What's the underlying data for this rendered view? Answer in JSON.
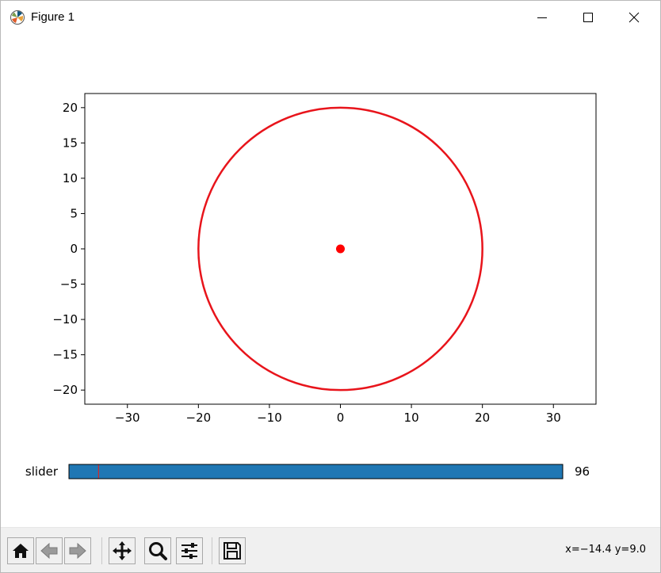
{
  "window": {
    "title": "Figure 1"
  },
  "chart_data": {
    "type": "line",
    "title": "",
    "xlabel": "",
    "ylabel": "",
    "xlim": [
      -36,
      36
    ],
    "ylim": [
      -22,
      22
    ],
    "xticks": [
      -30,
      -20,
      -10,
      0,
      10,
      20,
      30
    ],
    "yticks": [
      -20,
      -15,
      -10,
      -5,
      0,
      5,
      10,
      15,
      20
    ],
    "grid": false,
    "series": [
      {
        "kind": "circle",
        "center": [
          0,
          0
        ],
        "radius": 20,
        "color": "#e8141b"
      },
      {
        "kind": "point",
        "x": 0,
        "y": 0,
        "color": "#ff0000"
      }
    ],
    "aspect": "equal"
  },
  "slider": {
    "label": "slider",
    "value": 96,
    "value_text": "96",
    "min": 0,
    "max": 1000,
    "initial": 60,
    "fill_color": "#1f77b4",
    "marker_color": "#d62728"
  },
  "toolbar": {
    "buttons": [
      "home-icon",
      "back-icon",
      "forward-icon",
      "pan-icon",
      "zoom-icon",
      "configure-subplots-icon",
      "save-icon"
    ],
    "coords": "x=−14.4 y=9.0"
  }
}
